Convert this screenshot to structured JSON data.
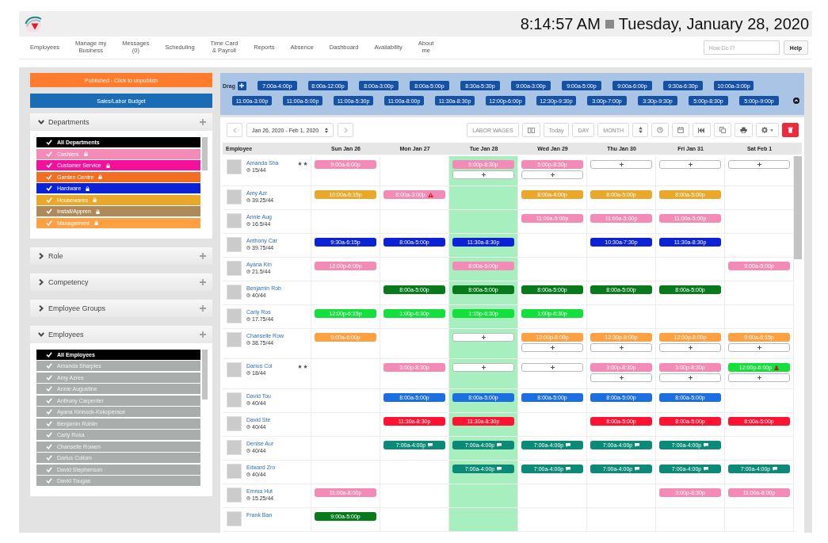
{
  "header": {
    "time": "8:14:57 AM",
    "date": "Tuesday, January 28, 2020"
  },
  "nav": [
    "Employees",
    "Manage my\nBusiness",
    "Messages\n(0)",
    "Scheduling",
    "Time Card\n& Payroll",
    "Reports",
    "Absence",
    "Dashboard",
    "Availability",
    "About\nme"
  ],
  "search": {
    "placeholder": "How Do I?"
  },
  "help_button": "Help",
  "sidebar": {
    "publish_button": "Published - Click to unpublish",
    "budget_button": "Sales/Labor Budget",
    "filters": [
      {
        "title": "Departments",
        "expanded": true,
        "items": [
          {
            "kind": "all",
            "label": "All Departments",
            "checked": true
          },
          {
            "kind": "department",
            "label": "Cashiers",
            "color": "#f38bb6",
            "checked": true,
            "locked": true
          },
          {
            "kind": "department",
            "label": "Customer Service",
            "color": "#f5109b",
            "checked": true,
            "locked": true
          },
          {
            "kind": "department",
            "label": "Garden Centre",
            "color": "#f26f22",
            "checked": true,
            "locked": true
          },
          {
            "kind": "department",
            "label": "Hardware",
            "color": "#0b22d6",
            "checked": true,
            "locked": true
          },
          {
            "kind": "department",
            "label": "Housewares",
            "color": "#eaa82a",
            "checked": true,
            "locked": true
          },
          {
            "kind": "department",
            "label": "Install/Appren",
            "color": "#b0895a",
            "checked": true,
            "locked": true
          },
          {
            "kind": "department",
            "label": "Management",
            "color": "#ffa043",
            "checked": true,
            "locked": true
          }
        ]
      },
      {
        "title": "Role",
        "expanded": false
      },
      {
        "title": "Competency",
        "expanded": false
      },
      {
        "title": "Employee Groups",
        "expanded": false
      },
      {
        "title": "Employees",
        "expanded": true,
        "items": [
          {
            "kind": "all",
            "label": "All Employees",
            "checked": true
          },
          {
            "kind": "employee",
            "label": "Amanda Sharples",
            "checked": true
          },
          {
            "kind": "employee",
            "label": "Amy Azree",
            "checked": true
          },
          {
            "kind": "employee",
            "label": "Annie Augustine",
            "checked": true
          },
          {
            "kind": "employee",
            "label": "Anthony Carpenter",
            "checked": true
          },
          {
            "kind": "employee",
            "label": "Ayana Kinnock-Kokoperace",
            "checked": true
          },
          {
            "kind": "employee",
            "label": "Benjamin Roblin",
            "checked": true
          },
          {
            "kind": "employee",
            "label": "Carly Rosa",
            "checked": true
          },
          {
            "kind": "employee",
            "label": "Chanselle Rowen",
            "checked": true
          },
          {
            "kind": "employee",
            "label": "Darius Collom",
            "checked": true
          },
          {
            "kind": "employee",
            "label": "David Stephenson",
            "checked": true
          },
          {
            "kind": "employee",
            "label": "David Tougas",
            "checked": true
          }
        ]
      }
    ]
  },
  "schedule": {
    "drag_label": "Drag",
    "template_rows": [
      [
        "7:00a-4:00p",
        "8:00a-12:00p",
        "8:00a-3:00p",
        "8:00a-5:00p",
        "8:30a-5:30p",
        "9:00a-3:00p",
        "9:00a-5:00p",
        "9:00a-6:00p",
        "9:30a-6:30p",
        "10:00a-3:00p"
      ],
      [
        "11:00a-3:00p",
        "11:00a-5:00p",
        "11:00a-5:30p",
        "11:00a-8:00p",
        "11:30a-8:30p",
        "12:00p-6:00p",
        "12:30p-9:30p",
        "3:00p-7:00p",
        "3:30p-9:30p",
        "5:00p-8:30p",
        "5:00p-9:00p"
      ]
    ],
    "date_range": "Jan 26, 2020 - Feb 1, 2020",
    "view_buttons": [
      "LABOR WAGES",
      "Today",
      "DAY",
      "MONTH"
    ],
    "employee_header": "Employee",
    "columns": [
      {
        "label": "Sun Jan 26",
        "today": false
      },
      {
        "label": "Mon Jan 27",
        "today": false
      },
      {
        "label": "Tue Jan 28",
        "today": true
      },
      {
        "label": "Wed Jan 29",
        "today": false
      },
      {
        "label": "Thu Jan 30",
        "today": false
      },
      {
        "label": "Fri Jan 31",
        "today": false
      },
      {
        "label": "Sat Feb 1",
        "today": false
      }
    ],
    "rows": [
      {
        "name": "Amanda Sha",
        "hours": "15/44",
        "starred": true,
        "cells": [
          {
            "shifts": [
              {
                "time": "9:00a-6:00p",
                "color": "#f38bb6"
              }
            ]
          },
          {},
          {
            "shifts": [
              {
                "time": "5:00p-8:30p",
                "color": "#f38bb6"
              }
            ],
            "add_slot": true
          },
          {
            "shifts": [
              {
                "time": "5:00p-8:30p",
                "color": "#f38bb6"
              }
            ],
            "add_slot": true
          },
          {
            "add_slot": true
          },
          {
            "add_slot": true
          },
          {
            "add_slot": true
          }
        ]
      },
      {
        "name": "Amy Azr",
        "hours": "39.25/44",
        "cells": [
          {
            "shifts": [
              {
                "time": "10:00a-6:15p",
                "color": "#eaa82a"
              }
            ]
          },
          {
            "shifts": [
              {
                "time": "8:00a-3:00p",
                "color": "#f38bb6",
                "warning": true
              }
            ]
          },
          {},
          {
            "shifts": [
              {
                "time": "8:00a-4:00p",
                "color": "#eaa82a"
              }
            ]
          },
          {
            "shifts": [
              {
                "time": "8:00a-5:00p",
                "color": "#eaa82a"
              }
            ]
          },
          {
            "shifts": [
              {
                "time": "8:00a-5:00p",
                "color": "#eaa82a"
              }
            ]
          },
          {}
        ]
      },
      {
        "name": "Annie Aug",
        "hours": "16.5/44",
        "cells": [
          {},
          {},
          {},
          {
            "shifts": [
              {
                "time": "11:00a-5:00p",
                "color": "#f38bb6"
              }
            ]
          },
          {
            "shifts": [
              {
                "time": "11:00a-5:00p",
                "color": "#f38bb6"
              }
            ]
          },
          {
            "shifts": [
              {
                "time": "11:00a-5:00p",
                "color": "#f38bb6"
              }
            ]
          },
          {}
        ]
      },
      {
        "name": "Anthony Car",
        "hours": "39.75/44",
        "cells": [
          {
            "shifts": [
              {
                "time": "9:30a-6:15p",
                "color": "#0b22d6"
              }
            ]
          },
          {
            "shifts": [
              {
                "time": "8:00a-5:00p",
                "color": "#0b22d6"
              }
            ]
          },
          {
            "shifts": [
              {
                "time": "11:30a-8:30p",
                "color": "#0b22d6"
              }
            ]
          },
          {},
          {
            "shifts": [
              {
                "time": "10:30a-7:30p",
                "color": "#0b22d6"
              }
            ]
          },
          {
            "shifts": [
              {
                "time": "11:30a-8:30p",
                "color": "#0b22d6"
              }
            ]
          },
          {}
        ]
      },
      {
        "name": "Ayana Kin",
        "hours": "21.5/44",
        "cells": [
          {
            "shifts": [
              {
                "time": "12:00p-6:00p",
                "color": "#f38bb6"
              }
            ]
          },
          {},
          {
            "shifts": [
              {
                "time": "8:00a-5:00p",
                "color": "#f38bb6"
              }
            ]
          },
          {},
          {},
          {},
          {
            "shifts": [
              {
                "time": "9:00a-5:00p",
                "color": "#f38bb6"
              }
            ]
          }
        ]
      },
      {
        "name": "Benjamin Rob",
        "hours": "40/44",
        "cells": [
          {},
          {
            "shifts": [
              {
                "time": "8:00a-5:00p",
                "color": "#087a1c"
              }
            ]
          },
          {
            "shifts": [
              {
                "time": "8:00a-5:00p",
                "color": "#087a1c"
              }
            ]
          },
          {
            "shifts": [
              {
                "time": "8:00a-5:00p",
                "color": "#087a1c"
              }
            ]
          },
          {
            "shifts": [
              {
                "time": "8:00a-5:00p",
                "color": "#087a1c"
              }
            ]
          },
          {
            "shifts": [
              {
                "time": "8:00a-5:00p",
                "color": "#087a1c"
              }
            ]
          },
          {}
        ]
      },
      {
        "name": "Carly Ros",
        "hours": "17.75/44",
        "cells": [
          {
            "shifts": [
              {
                "time": "12:00p-6:15p",
                "color": "#14e03c"
              }
            ]
          },
          {
            "shifts": [
              {
                "time": "1:00p-6:30p",
                "color": "#14e03c"
              }
            ]
          },
          {
            "shifts": [
              {
                "time": "1:15p-6:30p",
                "color": "#14e03c"
              }
            ]
          },
          {
            "shifts": [
              {
                "time": "1:00p-6:30p",
                "color": "#14e03c"
              }
            ]
          },
          {},
          {},
          {}
        ]
      },
      {
        "name": "Chanselle Row",
        "hours": "38.75/44",
        "cells": [
          {
            "shifts": [
              {
                "time": "9:00a-6:00p",
                "color": "#ffa043"
              }
            ]
          },
          {},
          {
            "add_slot": true
          },
          {
            "shifts": [
              {
                "time": "12:00p-8:00p",
                "color": "#ffa043"
              }
            ],
            "add_slot": true
          },
          {
            "shifts": [
              {
                "time": "12:30p-8:00p",
                "color": "#ffa043"
              }
            ],
            "add_slot": true
          },
          {
            "shifts": [
              {
                "time": "12:00p-8:00p",
                "color": "#ffa043"
              }
            ],
            "add_slot": true
          },
          {
            "shifts": [
              {
                "time": "9:00a-6:15p",
                "color": "#ffa043"
              }
            ],
            "add_slot": true
          }
        ]
      },
      {
        "name": "Darius Col",
        "hours": "18/44",
        "starred": true,
        "cells": [
          {},
          {
            "shifts": [
              {
                "time": "3:00p-8:30p",
                "color": "#f38bb6"
              }
            ]
          },
          {
            "add_slot": true
          },
          {
            "add_slot": true
          },
          {
            "shifts": [
              {
                "time": "3:00p-8:30p",
                "color": "#f38bb6"
              }
            ],
            "add_slot": true
          },
          {
            "shifts": [
              {
                "time": "3:00p-8:30p",
                "color": "#f38bb6"
              }
            ],
            "add_slot": true
          },
          {
            "shifts": [
              {
                "time": "12:00p-6:00p",
                "color": "#14e03c",
                "conflict": true
              }
            ],
            "add_slot": true
          }
        ]
      },
      {
        "name": "David Tou",
        "hours": "40/44",
        "cells": [
          {},
          {
            "shifts": [
              {
                "time": "8:00a-5:00p",
                "color": "#1b6fe0"
              }
            ]
          },
          {
            "shifts": [
              {
                "time": "8:00a-5:00p",
                "color": "#1b6fe0"
              }
            ]
          },
          {
            "shifts": [
              {
                "time": "8:00a-5:00p",
                "color": "#1b6fe0"
              }
            ]
          },
          {
            "shifts": [
              {
                "time": "8:00a-5:00p",
                "color": "#1b6fe0"
              }
            ]
          },
          {
            "shifts": [
              {
                "time": "8:00a-5:00p",
                "color": "#1b6fe0"
              }
            ]
          },
          {}
        ]
      },
      {
        "name": "David Ste",
        "hours": "40/44",
        "cells": [
          {},
          {
            "shifts": [
              {
                "time": "11:30a-8:30p",
                "color": "#ff1232"
              }
            ]
          },
          {
            "shifts": [
              {
                "time": "11:30a-8:30p",
                "color": "#ff1232"
              }
            ]
          },
          {},
          {
            "shifts": [
              {
                "time": "8:00a-5:00p",
                "color": "#ff1232"
              }
            ]
          },
          {
            "shifts": [
              {
                "time": "8:00a-5:00p",
                "color": "#ff1232"
              }
            ]
          },
          {
            "shifts": [
              {
                "time": "8:00a-5:00p",
                "color": "#ff1232"
              }
            ]
          }
        ]
      },
      {
        "name": "Denise Aur",
        "hours": "40/44",
        "cells": [
          {},
          {
            "shifts": [
              {
                "time": "7:00a-4:00p",
                "color": "#0b8a78",
                "comment": true
              }
            ]
          },
          {
            "shifts": [
              {
                "time": "7:00a-4:00p",
                "color": "#0b8a78",
                "comment": true
              }
            ]
          },
          {
            "shifts": [
              {
                "time": "7:00a-4:00p",
                "color": "#0b8a78",
                "comment": true
              }
            ]
          },
          {
            "shifts": [
              {
                "time": "7:00a-4:00p",
                "color": "#0b8a78",
                "comment": true
              }
            ]
          },
          {
            "shifts": [
              {
                "time": "7:00a-4:00p",
                "color": "#0b8a78",
                "comment": true
              }
            ]
          },
          {}
        ]
      },
      {
        "name": "Edward Zro",
        "hours": "40/44",
        "cells": [
          {},
          {},
          {
            "shifts": [
              {
                "time": "7:00a-4:00p",
                "color": "#0b8a78",
                "comment": true
              }
            ]
          },
          {
            "shifts": [
              {
                "time": "7:00a-4:00p",
                "color": "#0b8a78",
                "comment": true
              }
            ]
          },
          {
            "shifts": [
              {
                "time": "7:00a-4:00p",
                "color": "#0b8a78",
                "comment": true
              }
            ]
          },
          {
            "shifts": [
              {
                "time": "7:00a-4:00p",
                "color": "#0b8a78",
                "comment": true
              }
            ]
          },
          {
            "shifts": [
              {
                "time": "7:00a-4:00p",
                "color": "#0b8a78",
                "comment": true
              }
            ]
          }
        ]
      },
      {
        "name": "Emma Hut",
        "hours": "15.25/44",
        "cells": [
          {
            "shifts": [
              {
                "time": "11:00a-8:00p",
                "color": "#f38bb6"
              }
            ]
          },
          {},
          {},
          {},
          {},
          {
            "shifts": [
              {
                "time": "3:00p-8:30p",
                "color": "#f38bb6"
              }
            ]
          },
          {
            "shifts": [
              {
                "time": "11:00a-8:00p",
                "color": "#f38bb6"
              }
            ]
          }
        ]
      },
      {
        "name": "Frank Ban",
        "cells": [
          {
            "shifts": [
              {
                "time": "9:00a-5:00p",
                "color": "#087a1c"
              }
            ]
          },
          {},
          {},
          {},
          {},
          {},
          {}
        ]
      }
    ]
  }
}
